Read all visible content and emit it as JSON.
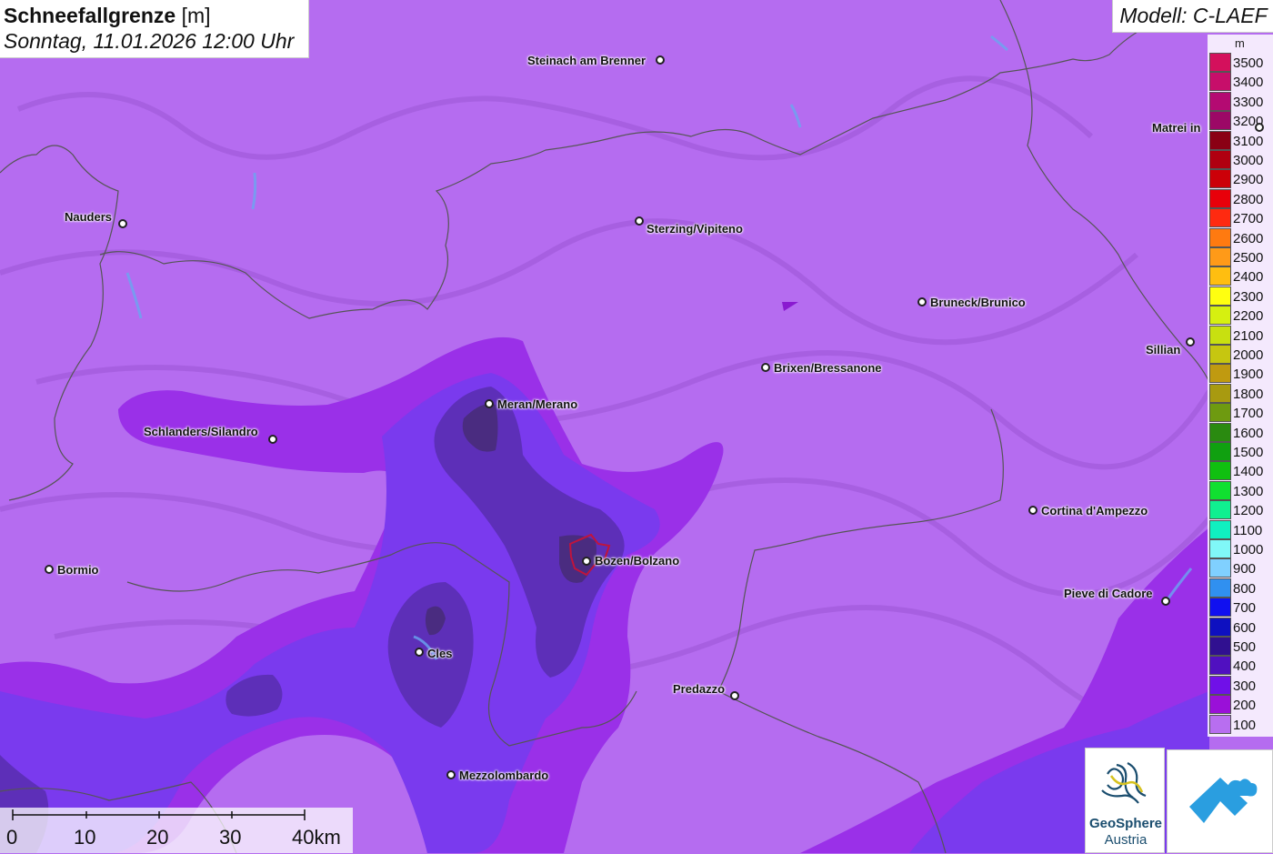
{
  "title": {
    "bold": "Schneefallgrenze",
    "unit": "[m]",
    "date": "Sonntag, 11.01.2026 12:00 Uhr"
  },
  "model_label": "Modell: C-LAEF",
  "legend": {
    "unit": "m",
    "entries": [
      {
        "label": "3500",
        "color": "#d4105c"
      },
      {
        "label": "3400",
        "color": "#c70e6a"
      },
      {
        "label": "3300",
        "color": "#b40a72"
      },
      {
        "label": "3200",
        "color": "#9c0866"
      },
      {
        "label": "3100",
        "color": "#8a0014"
      },
      {
        "label": "3000",
        "color": "#b00010"
      },
      {
        "label": "2900",
        "color": "#cc0008"
      },
      {
        "label": "2800",
        "color": "#e8000a"
      },
      {
        "label": "2700",
        "color": "#ff2a10"
      },
      {
        "label": "2600",
        "color": "#ff7a10"
      },
      {
        "label": "2500",
        "color": "#ff9a18"
      },
      {
        "label": "2400",
        "color": "#ffbe10"
      },
      {
        "label": "2300",
        "color": "#ffff10"
      },
      {
        "label": "2200",
        "color": "#d6f010"
      },
      {
        "label": "2100",
        "color": "#c8e010"
      },
      {
        "label": "2000",
        "color": "#c6c610"
      },
      {
        "label": "1900",
        "color": "#c09a10"
      },
      {
        "label": "1800",
        "color": "#a89a10"
      },
      {
        "label": "1700",
        "color": "#6e9a10"
      },
      {
        "label": "1600",
        "color": "#2a8a10"
      },
      {
        "label": "1500",
        "color": "#10a010"
      },
      {
        "label": "1400",
        "color": "#10c010"
      },
      {
        "label": "1300",
        "color": "#10e030"
      },
      {
        "label": "1200",
        "color": "#10f090"
      },
      {
        "label": "1100",
        "color": "#10f0c0"
      },
      {
        "label": "1000",
        "color": "#80f8f8"
      },
      {
        "label": "900",
        "color": "#80d0ff"
      },
      {
        "label": "800",
        "color": "#3090f0"
      },
      {
        "label": "700",
        "color": "#1010f0"
      },
      {
        "label": "600",
        "color": "#0e10c0"
      },
      {
        "label": "500",
        "color": "#301090"
      },
      {
        "label": "400",
        "color": "#5010c0"
      },
      {
        "label": "300",
        "color": "#7010e8"
      },
      {
        "label": "200",
        "color": "#9a10d8"
      },
      {
        "label": "100",
        "color": "#b86ef0"
      }
    ]
  },
  "cities": [
    {
      "name": "Steinach am Brenner"
    },
    {
      "name": "Matrei in"
    },
    {
      "name": "Nauders"
    },
    {
      "name": "Sterzing/Vipiteno"
    },
    {
      "name": "Bruneck/Brunico"
    },
    {
      "name": "Sillian"
    },
    {
      "name": "Brixen/Bressanone"
    },
    {
      "name": "Meran/Merano"
    },
    {
      "name": "Schlanders/Silandro"
    },
    {
      "name": "Cortina d'Ampezzo"
    },
    {
      "name": "Bormio"
    },
    {
      "name": "Bozen/Bolzano"
    },
    {
      "name": "Pieve di Cadore"
    },
    {
      "name": "Cles"
    },
    {
      "name": "Predazzo"
    },
    {
      "name": "Mezzolombardo"
    }
  ],
  "scale_bar": {
    "labels": [
      "0",
      "10",
      "20",
      "30",
      "40km"
    ]
  },
  "logo": {
    "line1": "GeoSphere",
    "line2": "Austria"
  },
  "colors": {
    "base_fill": "#b56cf0",
    "band_200": "#9a30e8",
    "band_300": "#7a3aee",
    "band_400": "#5d2fb8",
    "band_500": "#4a2c80"
  }
}
